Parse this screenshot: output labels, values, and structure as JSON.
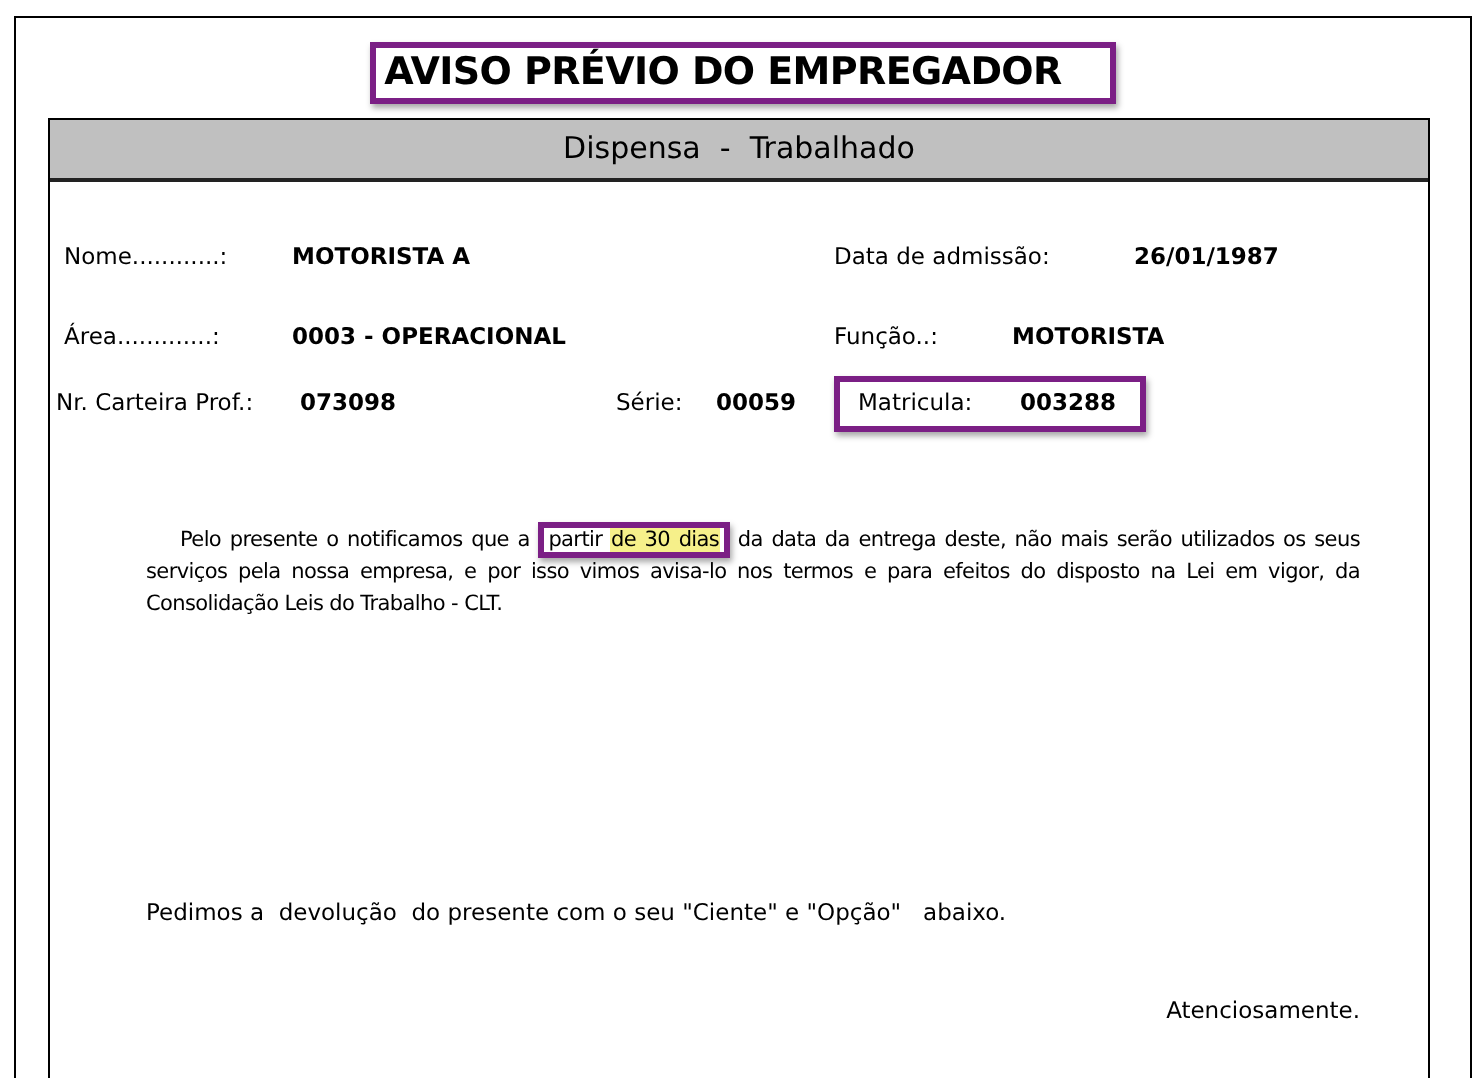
{
  "title": {
    "text": "AVISO PRÉVIO DO EMPREGADOR",
    "framed": true
  },
  "subtitle": "Dispensa  -  Trabalhado",
  "field_rows": [
    {
      "fields": [
        {
          "label": "Nome............:",
          "value": "MOTORISTA A",
          "framed": false
        },
        {
          "label": "Data de admissão:",
          "value": "26/01/1987",
          "framed": false
        }
      ]
    },
    {
      "fields": [
        {
          "label": "Área.............:",
          "value": "0003 -  OPERACIONAL",
          "framed": false
        },
        {
          "label": "Função..:",
          "value": "MOTORISTA",
          "framed": false
        }
      ]
    },
    {
      "fields": [
        {
          "label": "Nr. Carteira Prof.:",
          "value": "073098",
          "framed": false
        },
        {
          "label": "Série:",
          "value": "00059",
          "framed": false
        },
        {
          "label": "Matricula:",
          "value": "003288",
          "framed": true
        }
      ]
    }
  ],
  "notice": {
    "before": "Pelo presente o notificamos que a ",
    "framed_start": "partir ",
    "highlighted": "de 30 dias",
    "after": "  da data da entrega  deste, não mais serão utilizados os seus serviços pela nossa empresa, e por isso vimos avisa-lo nos termos e para efeitos do disposto na Lei em vigor, da Consolidação Leis do Trabalho - CLT."
  },
  "request": "Pedimos a  devolução  do presente com o seu \"Ciente\" e \"Opção\"   abaixo.",
  "closing": "Atenciosamente."
}
